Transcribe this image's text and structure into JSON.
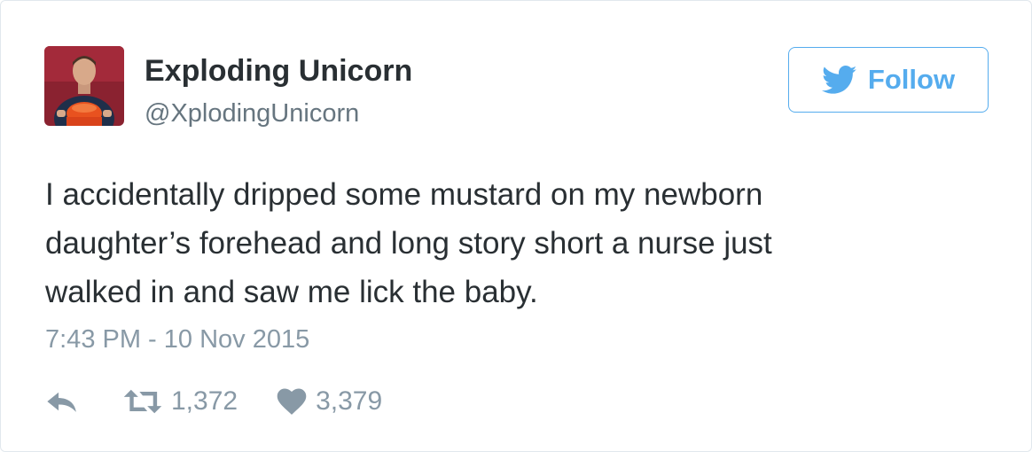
{
  "user": {
    "display_name": "Exploding Unicorn",
    "handle": "@XplodingUnicorn",
    "avatar_icon": "profile-photo"
  },
  "follow_button": {
    "label": "Follow",
    "icon": "twitter-bird-icon",
    "color": "#55acee"
  },
  "tweet": {
    "text_lines": [
      "I accidentally dripped some mustard on my newborn",
      "daughter’s forehead and long story short a nurse just",
      "walked in and saw me lick the baby."
    ],
    "timestamp": "7:43 PM - 10 Nov 2015"
  },
  "actions": {
    "reply_icon": "reply-icon",
    "retweet_icon": "retweet-icon",
    "retweet_count": "1,372",
    "like_icon": "heart-icon",
    "like_count": "3,379"
  },
  "colors": {
    "text": "#292f33",
    "muted": "#8899a6",
    "border": "#e1e8ed"
  }
}
